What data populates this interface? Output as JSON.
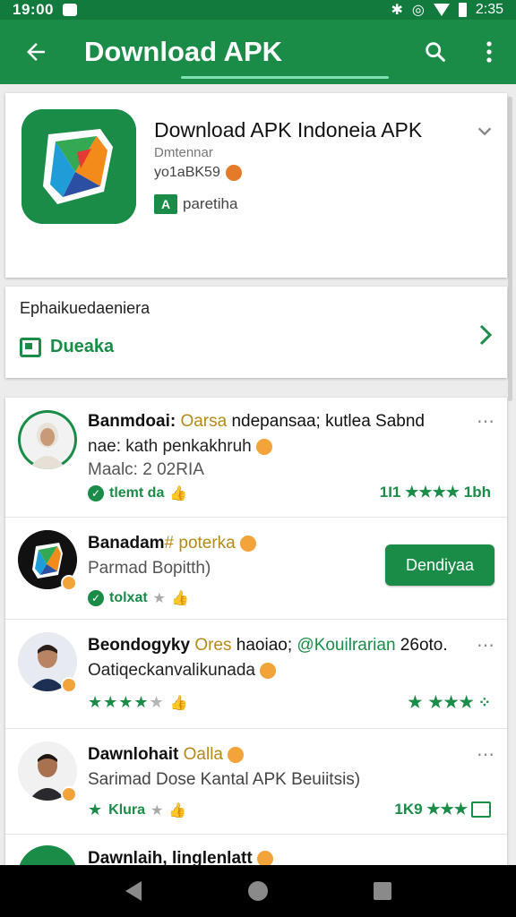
{
  "status_bar": {
    "time_left": "19:00",
    "time_right": "2:35"
  },
  "app_bar": {
    "title": "Download APK"
  },
  "app": {
    "name": "Download APK Indoneia APK",
    "developer": "Dmtennar",
    "meta": "yo1aBK59",
    "tag_letter": "A",
    "tag_label": "paretiha"
  },
  "section": {
    "title": "Ephaikuedaeniera",
    "link": "Dueaka"
  },
  "items": [
    {
      "line1_a": "Banmdoai: ",
      "line1_hl": "Oarsa",
      "line1_b": " ndepansaa; kutlea Sabnd",
      "line2": "nae: kath penkakhruh",
      "line3": "Maalc: 2 02RIA",
      "meta": "tlemt da",
      "rating_text": "1I1 ★★★★ 1bh"
    },
    {
      "line1_a": "Banadam",
      "line1_hl": "# poterka",
      "line2": "Parmad Bopitth)",
      "meta": "tolxat",
      "button": "Dendiyaa"
    },
    {
      "line1_a": "Beondogyky ",
      "line1_hl": "Ores",
      "line1_b": " haoiao; ",
      "line1_g": "@Kouilrarian",
      "line1_c": " 26oto.",
      "line2": "Oatiqeckanvalikunada",
      "stars_left": "★★★★",
      "stars_left_gray": "★",
      "stars_right": "★ ★★★"
    },
    {
      "line1_a": "Dawnlohait ",
      "line1_hl": "Oalla",
      "line2": "Sarimad Dose Kantal APK Beuiitsis)",
      "meta": "Klura",
      "rating_text": "1K9 ★★★"
    },
    {
      "line1_a": "Dawnlaih, linglenlatt"
    }
  ]
}
